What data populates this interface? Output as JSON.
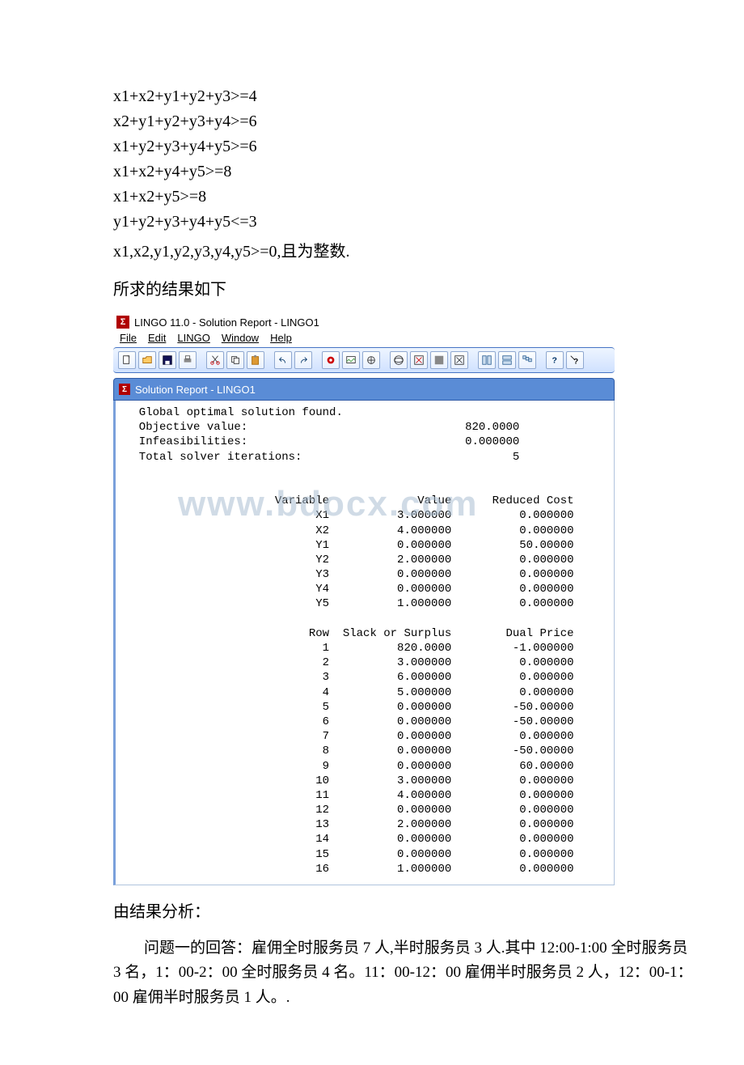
{
  "constraints": [
    "x1+x2+y1+y2+y3>=4",
    "x2+y1+y2+y3+y4>=6",
    "x1+y2+y3+y4+y5>=6",
    "x1+x2+y4+y5>=8",
    "x1+x2+y5>=8",
    "y1+y2+y3+y4+y5<=3",
    "x1,x2,y1,y2,y3,y4,y5>=0,且为整数."
  ],
  "result_heading": "所求的结果如下",
  "lingo": {
    "title": "LINGO 11.0 - Solution Report - LINGO1",
    "menus": [
      "File",
      "Edit",
      "LINGO",
      "Window",
      "Help"
    ],
    "tab": "Solution Report - LINGO1",
    "summary": {
      "line1_label": "Global optimal solution found.",
      "obj_label": "Objective value:",
      "obj_value": "820.0000",
      "infeas_label": "Infeasibilities:",
      "infeas_value": "0.000000",
      "iter_label": "Total solver iterations:",
      "iter_value": "5"
    },
    "var_header": {
      "c1": "Variable",
      "c2": "Value",
      "c3": "Reduced Cost"
    },
    "vars": [
      {
        "n": "X1",
        "v": "3.000000",
        "r": "0.000000"
      },
      {
        "n": "X2",
        "v": "4.000000",
        "r": "0.000000"
      },
      {
        "n": "Y1",
        "v": "0.000000",
        "r": "50.00000"
      },
      {
        "n": "Y2",
        "v": "2.000000",
        "r": "0.000000"
      },
      {
        "n": "Y3",
        "v": "0.000000",
        "r": "0.000000"
      },
      {
        "n": "Y4",
        "v": "0.000000",
        "r": "0.000000"
      },
      {
        "n": "Y5",
        "v": "1.000000",
        "r": "0.000000"
      }
    ],
    "row_header": {
      "c1": "Row",
      "c2": "Slack or Surplus",
      "c3": "Dual Price"
    },
    "rows": [
      {
        "n": "1",
        "v": "820.0000",
        "r": "-1.000000"
      },
      {
        "n": "2",
        "v": "3.000000",
        "r": "0.000000"
      },
      {
        "n": "3",
        "v": "6.000000",
        "r": "0.000000"
      },
      {
        "n": "4",
        "v": "5.000000",
        "r": "0.000000"
      },
      {
        "n": "5",
        "v": "0.000000",
        "r": "-50.00000"
      },
      {
        "n": "6",
        "v": "0.000000",
        "r": "-50.00000"
      },
      {
        "n": "7",
        "v": "0.000000",
        "r": "0.000000"
      },
      {
        "n": "8",
        "v": "0.000000",
        "r": "-50.00000"
      },
      {
        "n": "9",
        "v": "0.000000",
        "r": "60.00000"
      },
      {
        "n": "10",
        "v": "3.000000",
        "r": "0.000000"
      },
      {
        "n": "11",
        "v": "4.000000",
        "r": "0.000000"
      },
      {
        "n": "12",
        "v": "0.000000",
        "r": "0.000000"
      },
      {
        "n": "13",
        "v": "2.000000",
        "r": "0.000000"
      },
      {
        "n": "14",
        "v": "0.000000",
        "r": "0.000000"
      },
      {
        "n": "15",
        "v": "0.000000",
        "r": "0.000000"
      },
      {
        "n": "16",
        "v": "1.000000",
        "r": "0.000000"
      }
    ]
  },
  "analysis_heading": "由结果分析：",
  "analysis_para": "问题一的回答：雇佣全时服务员 7 人,半时服务员 3 人.其中 12:00-1:00 全时服务员 3 名，1：00-2：00 全时服务员 4 名。11：00-12：00 雇佣半时服务员 2 人，12：00-1：00 雇佣半时服务员 1 人。.",
  "watermark": "www.bdocx.com",
  "icons": {
    "new": "new-icon",
    "open": "open-icon",
    "save": "save-icon",
    "print": "print-icon",
    "cut": "cut-icon",
    "copy": "copy-icon",
    "paste": "paste-icon",
    "undo": "undo-icon",
    "redo": "redo-icon",
    "solve": "solve-icon",
    "picture": "picture-icon",
    "options": "options-icon",
    "matrix": "matrix-icon",
    "xwin": "x-window-icon",
    "close": "close-icon",
    "tileh": "tile-h-icon",
    "tilev": "tile-v-icon",
    "cascade": "cascade-icon",
    "help": "help-icon",
    "contexthelp": "context-help-icon"
  }
}
